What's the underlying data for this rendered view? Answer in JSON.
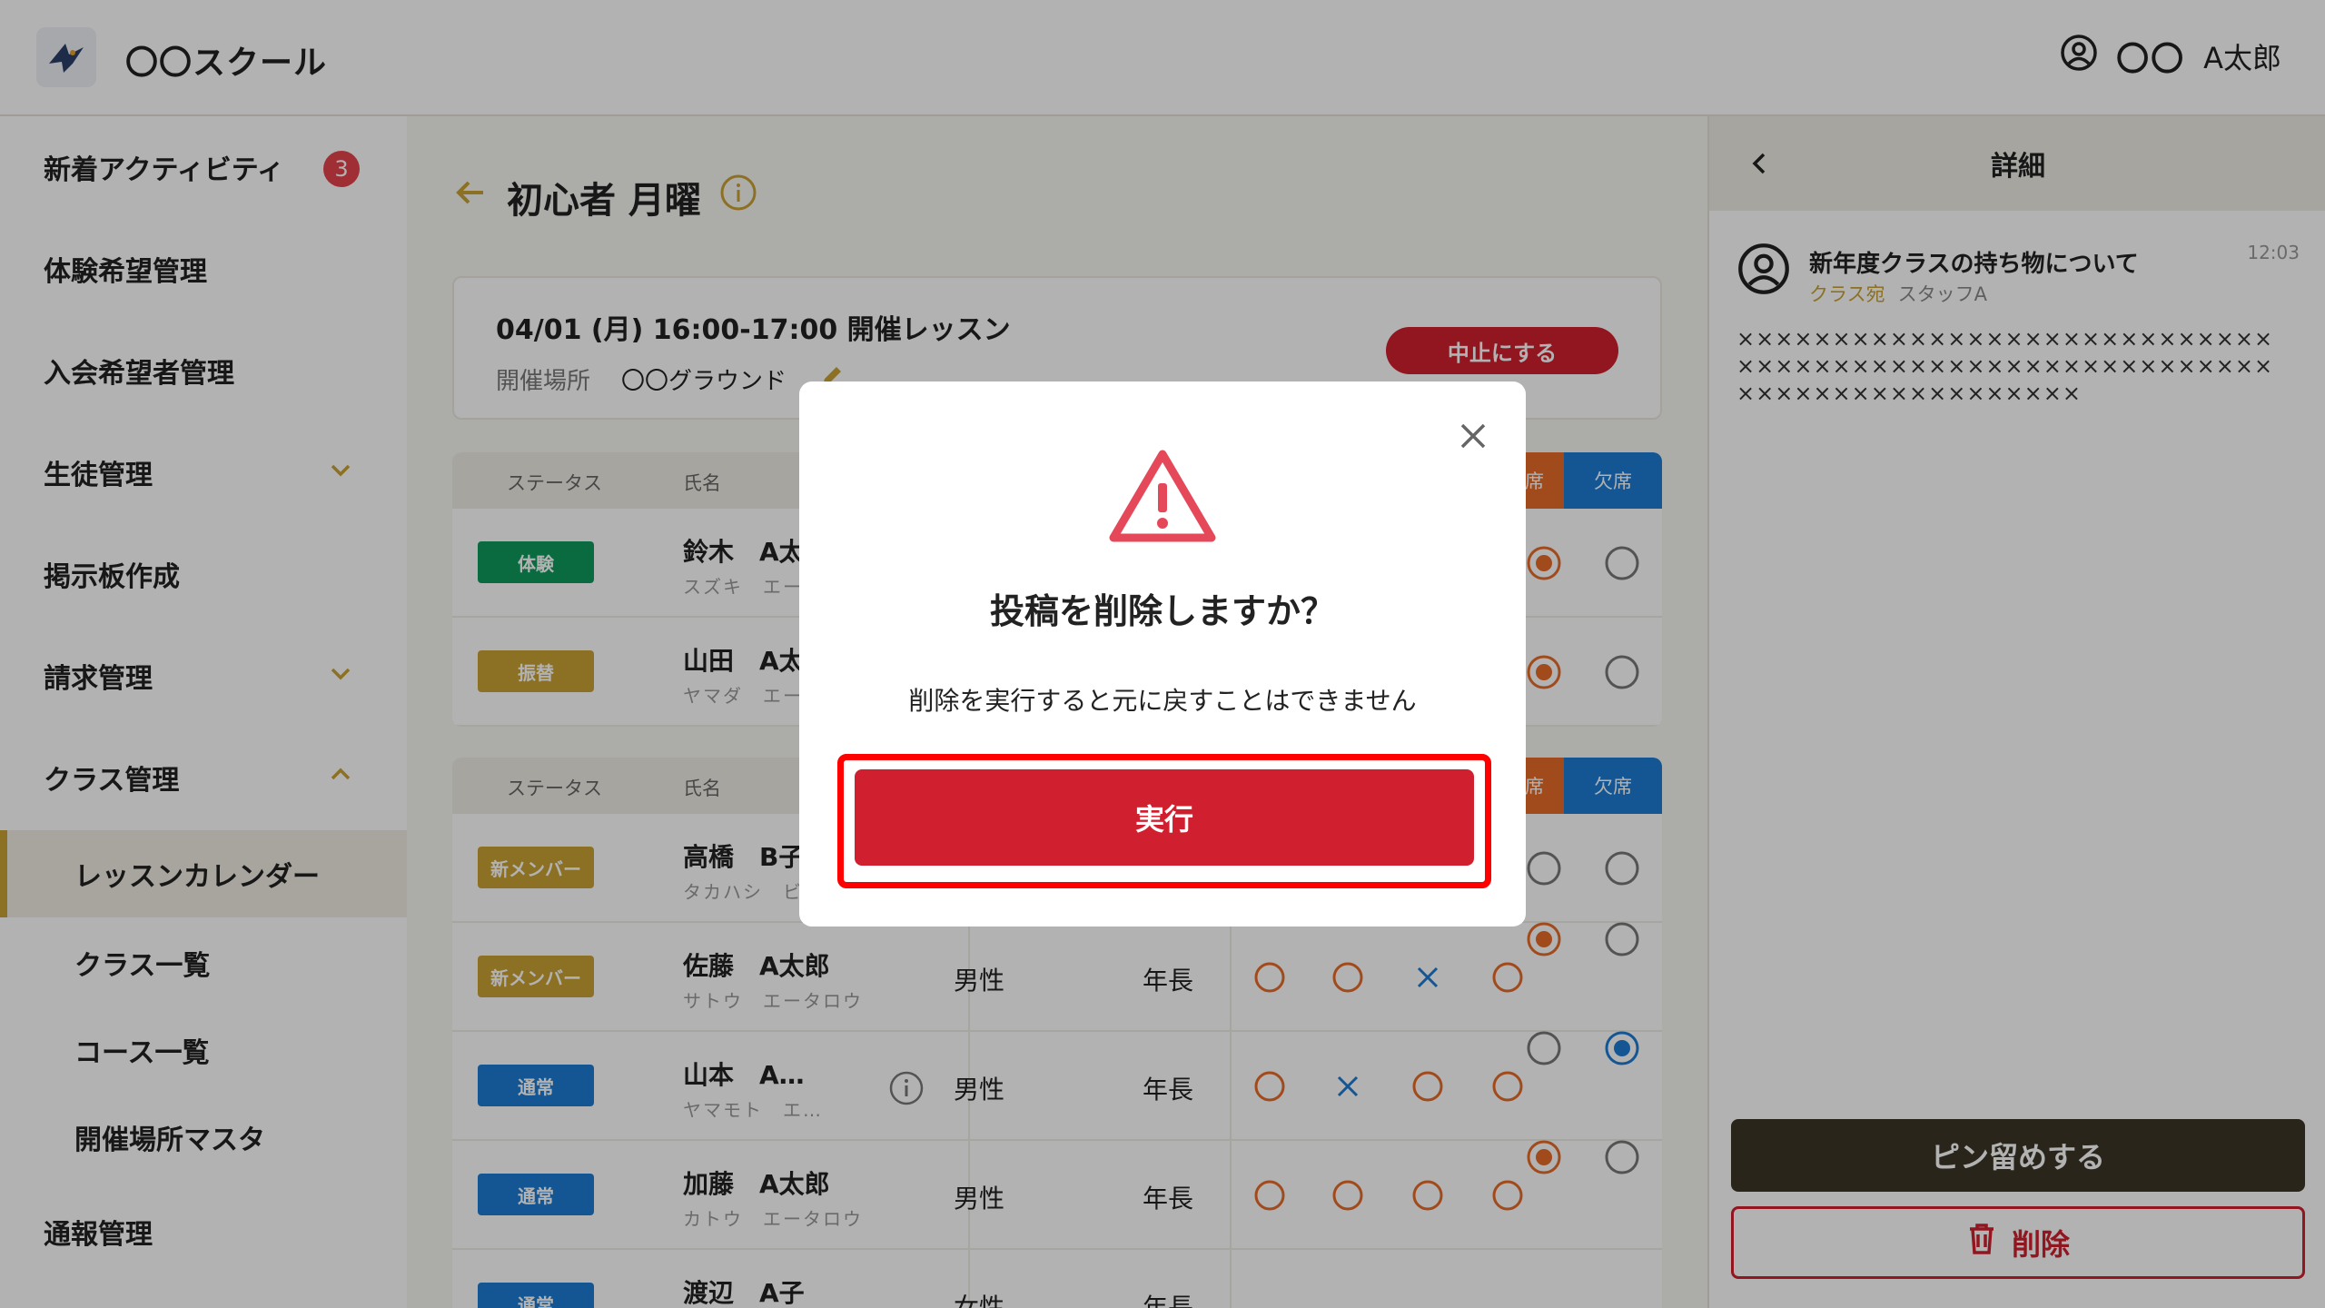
{
  "app": {
    "name": "〇〇スクール",
    "org": "〇〇",
    "user": "A太郎"
  },
  "sidebar": {
    "items": [
      {
        "label": "新着アクティビティ",
        "badge": "3"
      },
      {
        "label": "体験希望管理"
      },
      {
        "label": "入会希望者管理"
      },
      {
        "label": "生徒管理"
      },
      {
        "label": "掲示板作成"
      },
      {
        "label": "請求管理"
      },
      {
        "label": "クラス管理"
      },
      {
        "label": "レッスンカレンダー"
      },
      {
        "label": "クラス一覧"
      },
      {
        "label": "コース一覧"
      },
      {
        "label": "開催場所マスタ"
      },
      {
        "label": "通報管理"
      }
    ]
  },
  "main": {
    "title": "初心者 月曜",
    "lesson": {
      "title": "04/01 (月) 16:00-17:00 開催レッスン",
      "location_label": "開催場所",
      "location_value": "〇〇グラウンド",
      "cancel_label": "中止にする"
    },
    "table": {
      "headers": {
        "status": "ステータス",
        "name": "氏名",
        "attend": "出席",
        "absent": "欠席"
      },
      "rows": [
        {
          "status": "体験",
          "name": "鈴木　A太",
          "kana": "スズキ　エー",
          "status_color": "#0f9a5c"
        },
        {
          "status": "振替",
          "name": "山田　A太",
          "kana": "ヤマダ　エー",
          "status_color": "#c9a133"
        },
        {
          "status": "新メンバー",
          "name": "高橋　B子",
          "kana": "タカハシ　ビー",
          "status_color": "#c9a133"
        },
        {
          "status": "新メンバー",
          "name": "佐藤　A太郎",
          "kana": "サトウ　エータロウ",
          "sex": "男性",
          "age": "年長",
          "status_color": "#c9a133"
        },
        {
          "status": "通常",
          "name": "山本　A…",
          "kana": "ヤマモト　エ…",
          "sex": "男性",
          "age": "年長",
          "status_color": "#1d7cd4"
        },
        {
          "status": "通常",
          "name": "加藤　A太郎",
          "kana": "カトウ　エータロウ",
          "sex": "男性",
          "age": "年長",
          "status_color": "#1d7cd4"
        },
        {
          "status": "通常",
          "name": "渡辺　A子",
          "kana": "",
          "sex": "女性",
          "age": "年長",
          "status_color": "#1d7cd4"
        }
      ]
    }
  },
  "detail": {
    "title": "詳細",
    "post": {
      "title": "新年度クラスの持ち物について",
      "time": "12:03",
      "class_label": "クラス宛",
      "staff": "スタッフA",
      "body": "××××××××××××××××××××××××××××××××××××××××××××××××××××××××××××××××××××××××××"
    },
    "pin_label": "ピン留めする",
    "delete_label": "削除"
  },
  "modal": {
    "title": "投稿を削除しますか？",
    "message": "削除を実行すると元に戻すことはできません",
    "execute_label": "実行"
  },
  "colors": {
    "accent": "#c9a133",
    "danger": "#d0202f",
    "attend": "#e76b28",
    "absent": "#1d7cd4"
  }
}
